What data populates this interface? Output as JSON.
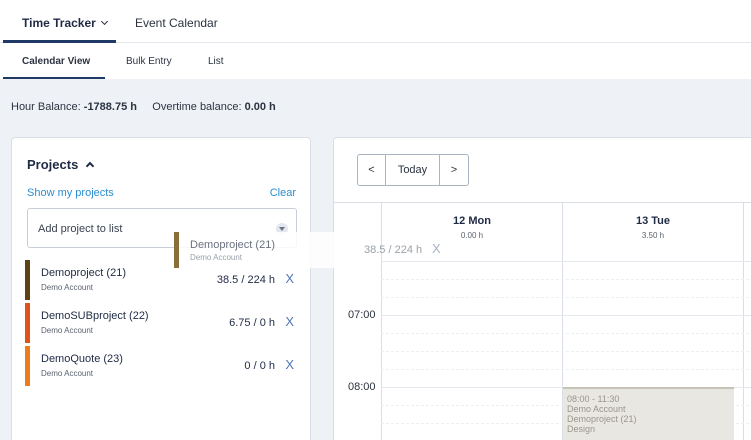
{
  "nav": {
    "tabs": [
      {
        "label": "Time Tracker"
      },
      {
        "label": "Event Calendar"
      }
    ]
  },
  "subnav": {
    "tabs": [
      {
        "label": "Calendar View"
      },
      {
        "label": "Bulk Entry"
      },
      {
        "label": "List"
      }
    ]
  },
  "balance": {
    "hour_label": "Hour Balance:",
    "hour_value": "-1788.75 h",
    "overtime_label": "Overtime balance:",
    "overtime_value": "0.00 h"
  },
  "projects": {
    "title": "Projects",
    "show_my_projects": "Show my projects",
    "clear": "Clear",
    "add_placeholder": "Add project to list",
    "items": [
      {
        "name": "Demoproject (21)",
        "account": "Demo Account",
        "hours": "38.5 / 224 h",
        "color": "#5c4316"
      },
      {
        "name": "DemoSUBproject (22)",
        "account": "Demo Account",
        "hours": "6.75 / 0 h",
        "color": "#e0521a"
      },
      {
        "name": "DemoQuote (23)",
        "account": "Demo Account",
        "hours": "0 / 0 h",
        "color": "#f07a1a"
      }
    ],
    "remove_label": "X",
    "drag_ghost": {
      "name": "Demoproject (21)",
      "account": "Demo Account",
      "hours": "38.5 / 224 h",
      "color": "#8a6d3b"
    }
  },
  "calendar": {
    "prev": "<",
    "today": "Today",
    "next": ">",
    "days": [
      {
        "day": "12 Mon",
        "hours": "0.00 h"
      },
      {
        "day": "13 Tue",
        "hours": "3.50 h"
      }
    ],
    "times": [
      "07:00",
      "08:00"
    ],
    "event": {
      "time": "08:00 - 11:30",
      "account": "Demo Account",
      "project": "Demoproject (21)",
      "type": "Design"
    }
  }
}
